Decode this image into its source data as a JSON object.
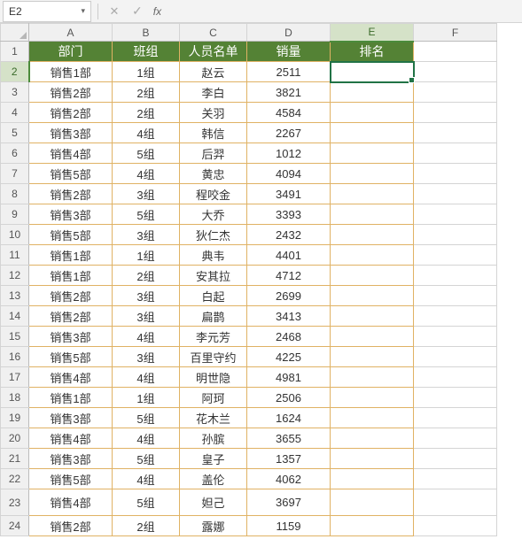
{
  "formula_bar": {
    "name_box": "E2",
    "fx": "fx",
    "formula_value": ""
  },
  "columns": [
    "A",
    "B",
    "C",
    "D",
    "E",
    "F"
  ],
  "selected_cell": {
    "col": "E",
    "row": 2
  },
  "header_row": {
    "A": "部门",
    "B": "班组",
    "C": "人员名单",
    "D": "销量",
    "E": "排名"
  },
  "rows": [
    {
      "n": 1,
      "type": "header"
    },
    {
      "n": 2,
      "A": "销售1部",
      "B": "1组",
      "C": "赵云",
      "D": "2511",
      "E": ""
    },
    {
      "n": 3,
      "A": "销售2部",
      "B": "2组",
      "C": "李白",
      "D": "3821",
      "E": ""
    },
    {
      "n": 4,
      "A": "销售2部",
      "B": "2组",
      "C": "关羽",
      "D": "4584",
      "E": ""
    },
    {
      "n": 5,
      "A": "销售3部",
      "B": "4组",
      "C": "韩信",
      "D": "2267",
      "E": ""
    },
    {
      "n": 6,
      "A": "销售4部",
      "B": "5组",
      "C": "后羿",
      "D": "1012",
      "E": ""
    },
    {
      "n": 7,
      "A": "销售5部",
      "B": "4组",
      "C": "黄忠",
      "D": "4094",
      "E": ""
    },
    {
      "n": 8,
      "A": "销售2部",
      "B": "3组",
      "C": "程咬金",
      "D": "3491",
      "E": ""
    },
    {
      "n": 9,
      "A": "销售3部",
      "B": "5组",
      "C": "大乔",
      "D": "3393",
      "E": ""
    },
    {
      "n": 10,
      "A": "销售5部",
      "B": "3组",
      "C": "狄仁杰",
      "D": "2432",
      "E": ""
    },
    {
      "n": 11,
      "A": "销售1部",
      "B": "1组",
      "C": "典韦",
      "D": "4401",
      "E": ""
    },
    {
      "n": 12,
      "A": "销售1部",
      "B": "2组",
      "C": "安其拉",
      "D": "4712",
      "E": ""
    },
    {
      "n": 13,
      "A": "销售2部",
      "B": "3组",
      "C": "白起",
      "D": "2699",
      "E": ""
    },
    {
      "n": 14,
      "A": "销售2部",
      "B": "3组",
      "C": "扁鹊",
      "D": "3413",
      "E": ""
    },
    {
      "n": 15,
      "A": "销售3部",
      "B": "4组",
      "C": "李元芳",
      "D": "2468",
      "E": ""
    },
    {
      "n": 16,
      "A": "销售5部",
      "B": "3组",
      "C": "百里守约",
      "D": "4225",
      "E": ""
    },
    {
      "n": 17,
      "A": "销售4部",
      "B": "4组",
      "C": "明世隐",
      "D": "4981",
      "E": ""
    },
    {
      "n": 18,
      "A": "销售1部",
      "B": "1组",
      "C": "阿珂",
      "D": "2506",
      "E": ""
    },
    {
      "n": 19,
      "A": "销售3部",
      "B": "5组",
      "C": "花木兰",
      "D": "1624",
      "E": ""
    },
    {
      "n": 20,
      "A": "销售4部",
      "B": "4组",
      "C": "孙膑",
      "D": "3655",
      "E": ""
    },
    {
      "n": 21,
      "A": "销售3部",
      "B": "5组",
      "C": "皇子",
      "D": "1357",
      "E": ""
    },
    {
      "n": 22,
      "A": "销售5部",
      "B": "4组",
      "C": "盖伦",
      "D": "4062",
      "E": ""
    },
    {
      "n": 23,
      "A": "销售4部",
      "B": "5组",
      "C": "妲己",
      "D": "3697",
      "E": "",
      "tall": true
    },
    {
      "n": 24,
      "A": "销售2部",
      "B": "2组",
      "C": "露娜",
      "D": "1159",
      "E": ""
    }
  ],
  "chart_data": {
    "type": "table",
    "title": "",
    "columns": [
      "部门",
      "班组",
      "人员名单",
      "销量",
      "排名"
    ],
    "data": [
      [
        "销售1部",
        "1组",
        "赵云",
        2511,
        null
      ],
      [
        "销售2部",
        "2组",
        "李白",
        3821,
        null
      ],
      [
        "销售2部",
        "2组",
        "关羽",
        4584,
        null
      ],
      [
        "销售3部",
        "4组",
        "韩信",
        2267,
        null
      ],
      [
        "销售4部",
        "5组",
        "后羿",
        1012,
        null
      ],
      [
        "销售5部",
        "4组",
        "黄忠",
        4094,
        null
      ],
      [
        "销售2部",
        "3组",
        "程咬金",
        3491,
        null
      ],
      [
        "销售3部",
        "5组",
        "大乔",
        3393,
        null
      ],
      [
        "销售5部",
        "3组",
        "狄仁杰",
        2432,
        null
      ],
      [
        "销售1部",
        "1组",
        "典韦",
        4401,
        null
      ],
      [
        "销售1部",
        "2组",
        "安其拉",
        4712,
        null
      ],
      [
        "销售2部",
        "3组",
        "白起",
        2699,
        null
      ],
      [
        "销售2部",
        "3组",
        "扁鹊",
        3413,
        null
      ],
      [
        "销售3部",
        "4组",
        "李元芳",
        2468,
        null
      ],
      [
        "销售5部",
        "3组",
        "百里守约",
        4225,
        null
      ],
      [
        "销售4部",
        "4组",
        "明世隐",
        4981,
        null
      ],
      [
        "销售1部",
        "1组",
        "阿珂",
        2506,
        null
      ],
      [
        "销售3部",
        "5组",
        "花木兰",
        1624,
        null
      ],
      [
        "销售4部",
        "4组",
        "孙膑",
        3655,
        null
      ],
      [
        "销售3部",
        "5组",
        "皇子",
        1357,
        null
      ],
      [
        "销售5部",
        "4组",
        "盖伦",
        4062,
        null
      ],
      [
        "销售4部",
        "5组",
        "妲己",
        3697,
        null
      ],
      [
        "销售2部",
        "2组",
        "露娜",
        1159,
        null
      ]
    ]
  }
}
